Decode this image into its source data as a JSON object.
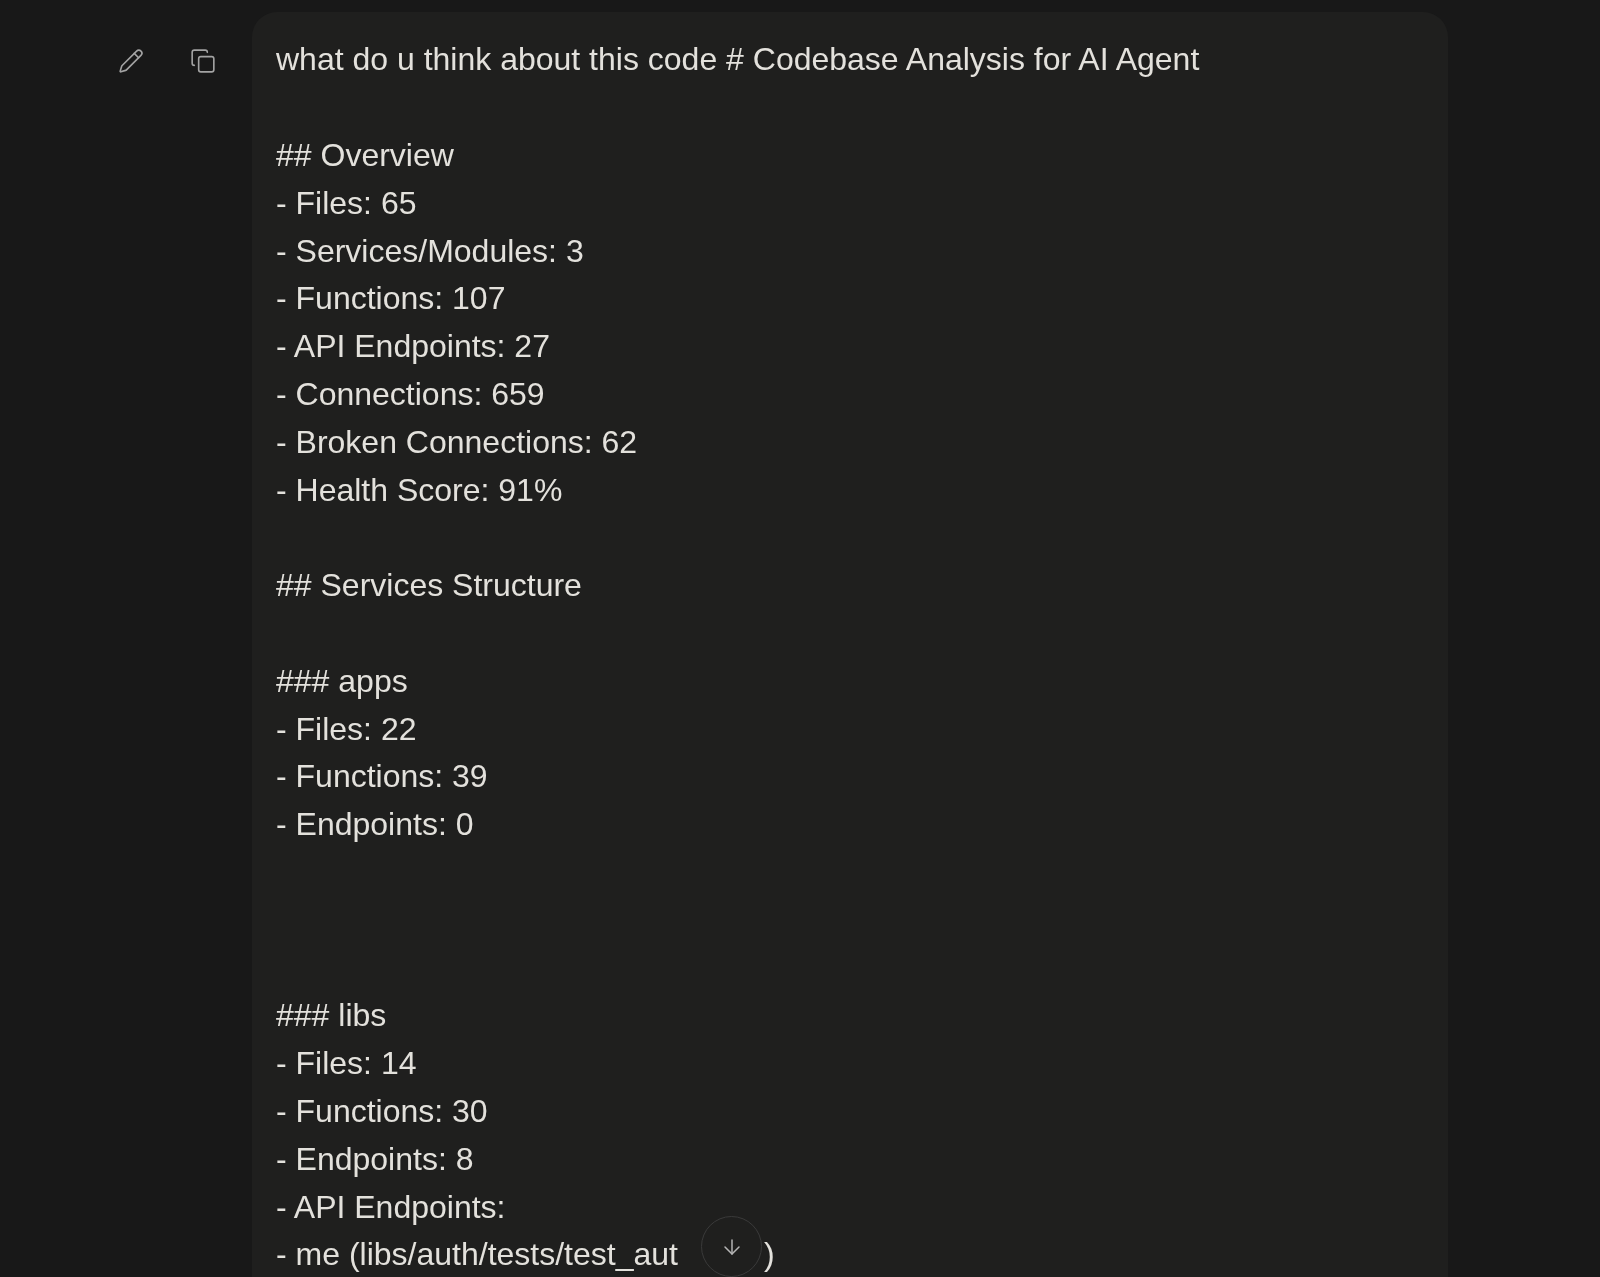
{
  "message": {
    "lines": [
      {
        "kind": "text",
        "text": "what do u think about this code # Codebase Analysis for AI Agent"
      },
      {
        "kind": "blank"
      },
      {
        "kind": "text",
        "text": "## Overview"
      },
      {
        "kind": "text",
        "text": "- Files: 65"
      },
      {
        "kind": "text",
        "text": "- Services/Modules: 3"
      },
      {
        "kind": "text",
        "text": "- Functions: 107"
      },
      {
        "kind": "text",
        "text": "- API Endpoints: 27"
      },
      {
        "kind": "text",
        "text": "- Connections: 659"
      },
      {
        "kind": "text",
        "text": "- Broken Connections: 62"
      },
      {
        "kind": "text",
        "text": "- Health Score: 91%"
      },
      {
        "kind": "blank"
      },
      {
        "kind": "text",
        "text": "## Services Structure"
      },
      {
        "kind": "blank"
      },
      {
        "kind": "text",
        "text": "### apps"
      },
      {
        "kind": "text",
        "text": "- Files: 22"
      },
      {
        "kind": "text",
        "text": "- Functions: 39"
      },
      {
        "kind": "text",
        "text": "- Endpoints: 0"
      },
      {
        "kind": "blank"
      },
      {
        "kind": "blank"
      },
      {
        "kind": "blank"
      },
      {
        "kind": "text",
        "text": "### libs"
      },
      {
        "kind": "text",
        "text": "- Files: 14"
      },
      {
        "kind": "text",
        "text": "- Functions: 30"
      },
      {
        "kind": "text",
        "text": "- Endpoints: 8"
      },
      {
        "kind": "text",
        "text": "- API Endpoints:"
      },
      {
        "kind": "covered",
        "parts": [
          "- me (libs/auth/tests/test_aut",
          ")"
        ]
      }
    ]
  }
}
